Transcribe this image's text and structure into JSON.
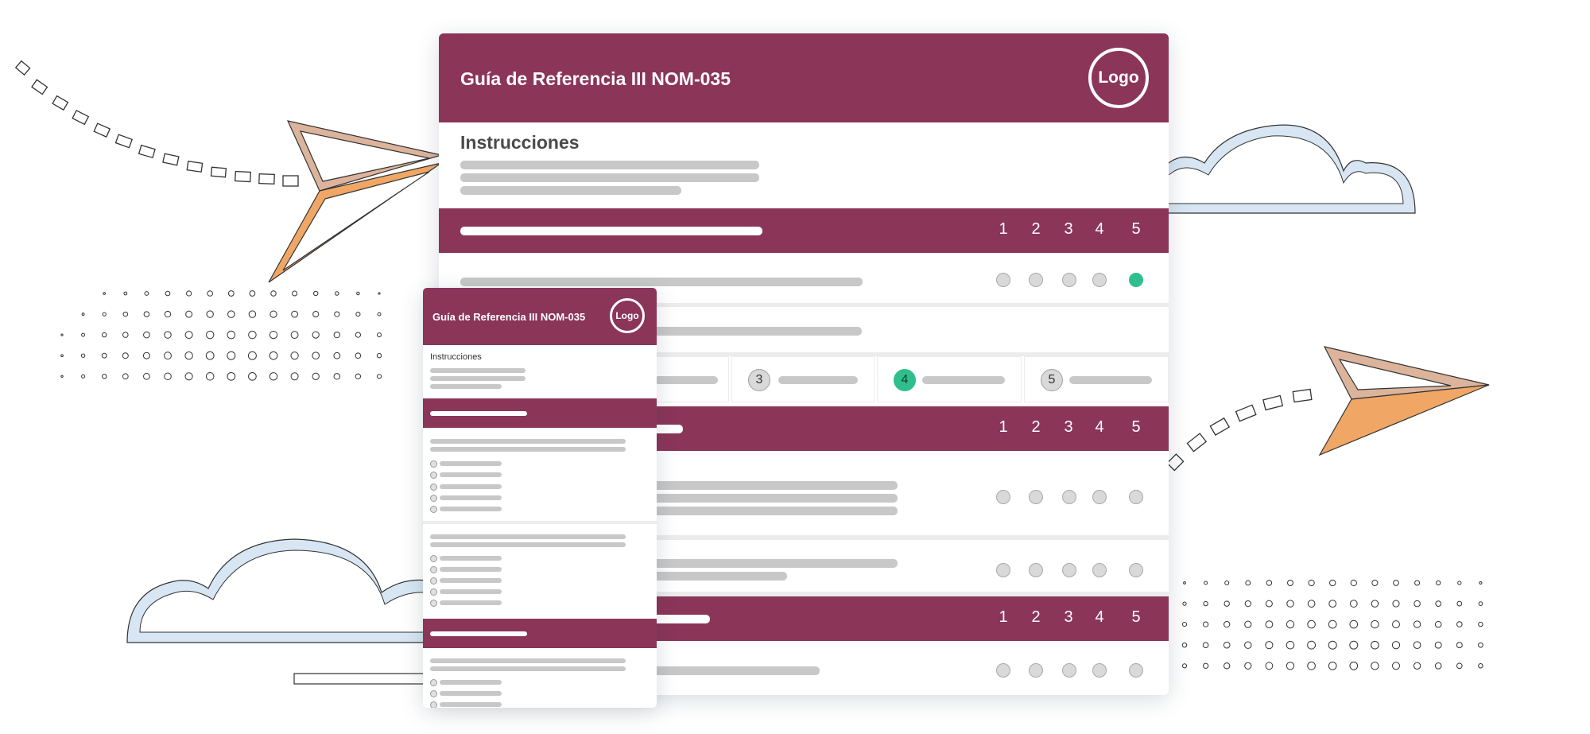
{
  "form": {
    "title": "Guía de Referencia III NOM-035",
    "logo_label": "Logo",
    "instructions_heading": "Instrucciones",
    "scale": [
      "1",
      "2",
      "3",
      "4",
      "5"
    ],
    "scale_cards": [
      "3",
      "4",
      "5"
    ],
    "selected_value": "5",
    "selected_card": "4"
  },
  "mobile": {
    "title": "Guía de Referencia III NOM-035",
    "logo_label": "Logo",
    "instructions_heading": "Instrucciones"
  },
  "colors": {
    "brand": "#8b3559",
    "selected": "#2fbf8c",
    "placeholder": "#c8c8c8"
  }
}
